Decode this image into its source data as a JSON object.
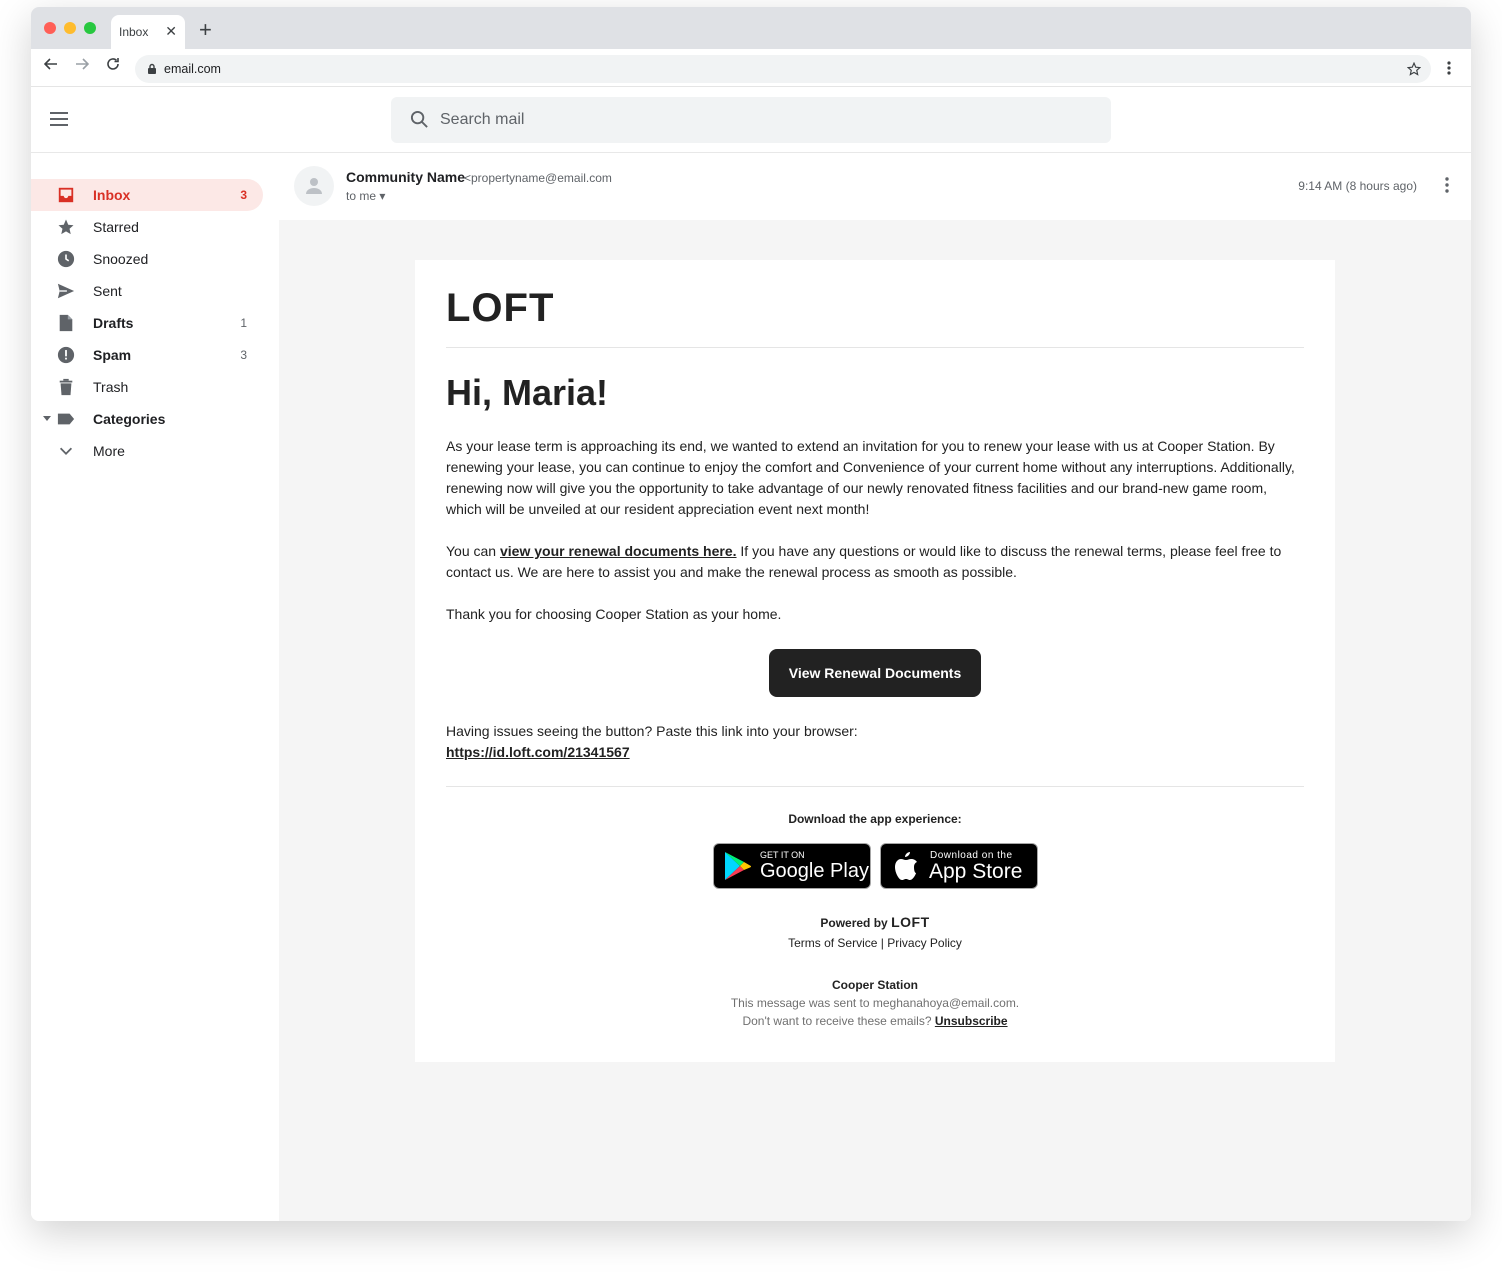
{
  "browser": {
    "tab_title": "Inbox",
    "url": "email.com"
  },
  "search": {
    "placeholder": "Search mail"
  },
  "sidebar": {
    "items": [
      {
        "label": "Inbox",
        "count": "3"
      },
      {
        "label": "Starred",
        "count": ""
      },
      {
        "label": "Snoozed",
        "count": ""
      },
      {
        "label": "Sent",
        "count": ""
      },
      {
        "label": "Drafts",
        "count": "1"
      },
      {
        "label": "Spam",
        "count": "3"
      },
      {
        "label": "Trash",
        "count": ""
      },
      {
        "label": "Categories",
        "count": ""
      },
      {
        "label": "More",
        "count": ""
      }
    ]
  },
  "message": {
    "sender_name": "Community Name",
    "sender_email": "<propertyname@email.com",
    "to": "to me",
    "time": "9:14 AM (8 hours ago)"
  },
  "email": {
    "logo_text": "LOFT",
    "greeting": "Hi, Maria!",
    "paragraph1": "As your lease term is approaching its end, we wanted to extend an invitation for you to renew your lease with us at Cooper Station. By renewing your lease, you can continue to enjoy the comfort and Convenience of your current home without any interruptions. Additionally, renewing now will give you the opportunity to take advantage of our newly renovated fitness facilities and our brand-new game room, which will be unveiled at our resident appreciation event next month!",
    "paragraph2_prefix": "You can ",
    "paragraph2_link": "view your renewal documents here.",
    "paragraph2_suffix": " If you have any questions or would like to discuss the renewal terms, please feel free to contact us. We are here to assist you and make the renewal process as smooth as possible.",
    "paragraph3": "Thank you for choosing Cooper Station as your home.",
    "cta_label": "View Renewal Documents",
    "fallback_text": "Having issues seeing the button? Paste this link into your browser:",
    "fallback_link": "https://id.loft.com/21341567",
    "download_heading": "Download the app experience:",
    "google_play_small": "GET IT ON",
    "google_play_big": "Google Play",
    "app_store_small": "Download on the",
    "app_store_big": "App Store",
    "powered_by": "Powered by",
    "terms": "Terms of Service",
    "separator": "|",
    "privacy": "Privacy Policy",
    "community": "Cooper Station",
    "sent_to": "This message was sent to meghanahoya@email.com.",
    "unsubscribe_prefix": "Don't want to receive these emails?",
    "unsubscribe": "Unsubscribe"
  },
  "colors": {
    "accent_red": "#d93025",
    "inbox_highlight": "#fce8e6",
    "button_dark": "#222222"
  }
}
